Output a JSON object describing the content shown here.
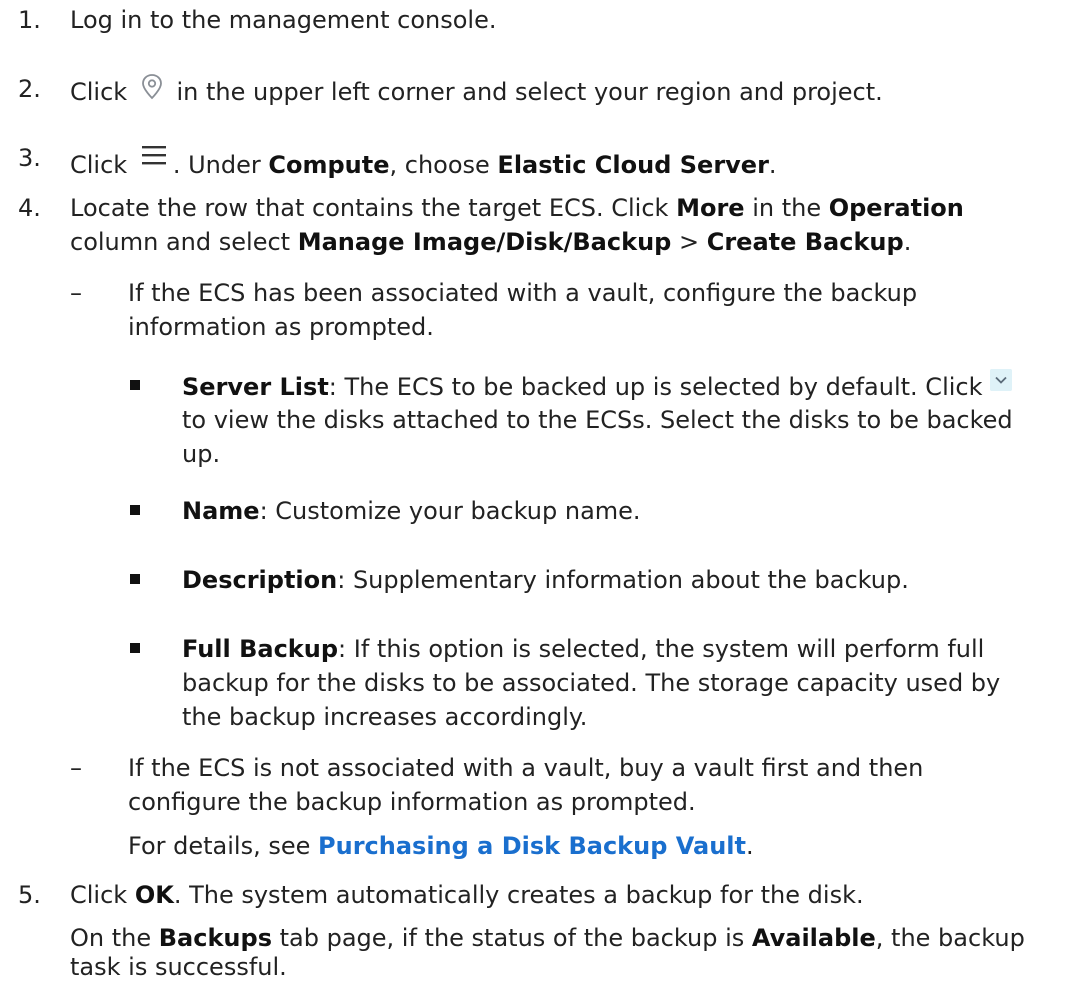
{
  "steps": {
    "s1": {
      "num": "1.",
      "text": "Log in to the management console."
    },
    "s2": {
      "num": "2.",
      "pre": "Click",
      "icon": "location-pin-icon",
      "post": "in the upper left corner and select your region and project."
    },
    "s3": {
      "num": "3.",
      "pre": "Click",
      "icon": "hamburger-menu-icon",
      "t1": ". Under ",
      "b1": "Compute",
      "t2": ", choose ",
      "b2": "Elastic Cloud Server",
      "t3": "."
    },
    "s4": {
      "num": "4.",
      "l1_t1": "Locate the row that contains the target ECS. Click ",
      "l1_b1": "More",
      "l1_t2": " in the ",
      "l1_b2": "Operation",
      "l2_t1": "column and select ",
      "l2_b1": "Manage Image/Disk/Backup",
      "l2_t2": " > ",
      "l2_b2": "Create Backup",
      "l2_t3": ".",
      "subA": {
        "dash": "–",
        "l1": "If the ECS has been associated with a vault, configure the backup",
        "l2": "information as prompted.",
        "bullets": {
          "server_list": {
            "label": "Server List",
            "l1_t": ": The ECS to be backed up is selected by default. Click",
            "icon": "chevron-down-icon",
            "l2": "to view the disks attached to the ECSs. Select the disks to be backed",
            "l3": "up."
          },
          "name": {
            "label": "Name",
            "text": ": Customize your backup name."
          },
          "description": {
            "label": "Description",
            "text": ": Supplementary information about the backup."
          },
          "full_backup": {
            "label": "Full Backup",
            "l1_t": ": If this option is selected, the system will perform full",
            "l2": "backup for the disks to be associated. The storage capacity used by",
            "l3": "the backup increases accordingly."
          }
        }
      },
      "subB": {
        "dash": "–",
        "l1": "If the ECS is not associated with a vault, buy a vault first and then",
        "l2": "configure the backup information as prompted.",
        "details_pre": "For details, see ",
        "details_link": "Purchasing a Disk Backup Vault",
        "details_post": "."
      }
    },
    "s5": {
      "num": "5.",
      "pre": "Click ",
      "b1": "OK",
      "post": ". The system automatically creates a backup for the disk.",
      "p2_t1": "On the ",
      "p2_b1": "Backups",
      "p2_t2": " tab page, if the status of the backup is ",
      "p2_b2": "Available",
      "p2_t3": ", the backup",
      "p3": "task is successful."
    }
  }
}
